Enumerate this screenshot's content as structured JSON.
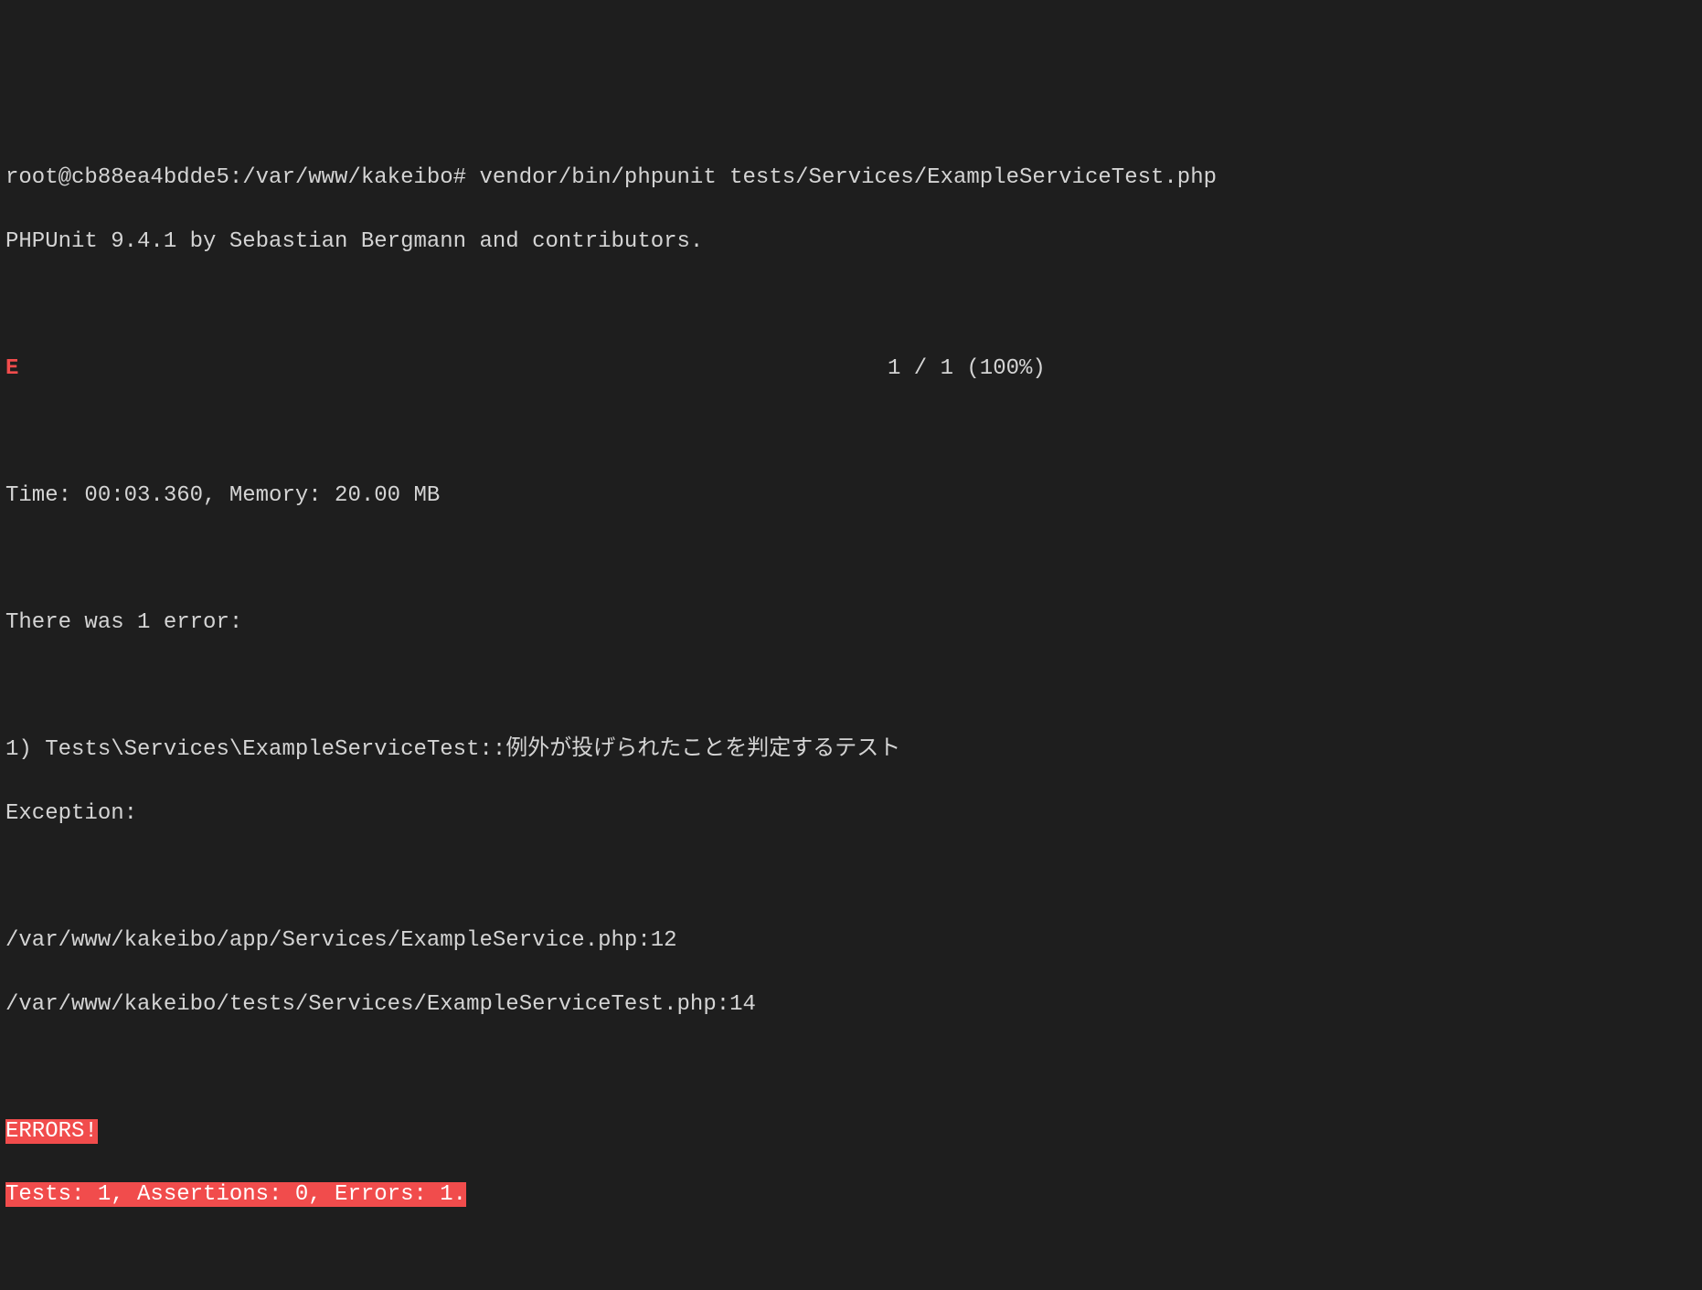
{
  "terminal": {
    "prompt": "root@cb88ea4bdde5:/var/www/kakeibo# ",
    "command": "vendor/bin/phpunit tests/Services/ExampleServiceTest.php",
    "phpunit_header": "PHPUnit 9.4.1 by Sebastian Bergmann and contributors.",
    "error_indicator": "E",
    "progress": "1 / 1 (100%)",
    "time_memory": "Time: 00:03.360, Memory: 20.00 MB",
    "error_count_header": "There was 1 error:",
    "error_item": "1) Tests\\Services\\ExampleServiceTest::例外が投げられたことを判定するテスト",
    "exception_label": "Exception:",
    "trace_line1": "/var/www/kakeibo/app/Services/ExampleService.php:12",
    "trace_line2": "/var/www/kakeibo/tests/Services/ExampleServiceTest.php:14",
    "errors_banner": "ERRORS!",
    "summary": "Tests: 1, Assertions: 0, Errors: 1."
  }
}
